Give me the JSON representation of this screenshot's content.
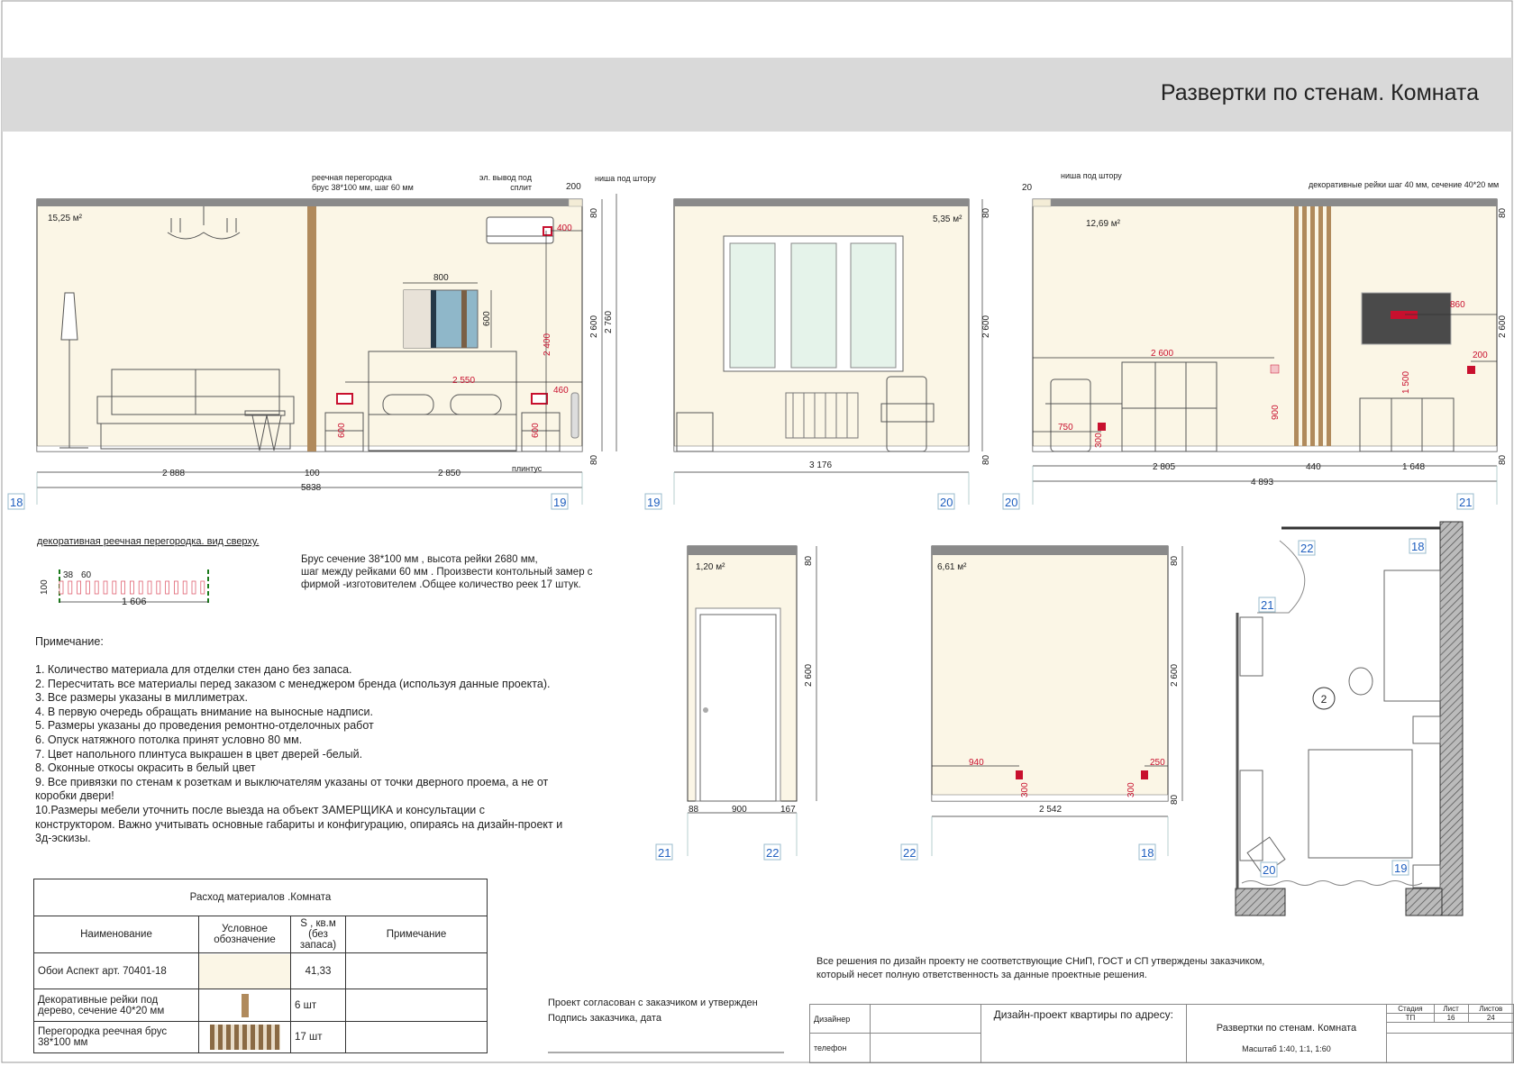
{
  "header": {
    "title": "Развертки по стенам. Комната"
  },
  "colors": {
    "wall": "#fbf6e6",
    "ceiling": "#8a8a8a",
    "header_band": "#d9d9d9",
    "accent_red": "#c8102e",
    "tag_blue": "#1f5fbf",
    "wood": "#b08a5c"
  },
  "elev1": {
    "area": "15,25 м²",
    "partition_note_1": "реечная перегородка",
    "partition_note_2": "брус 38*100 мм, шаг 60 мм",
    "outlet_note_1": "эл. вывод под",
    "outlet_note_2": "сплит",
    "niche_dim": "200",
    "niche_note": "ниша под штору",
    "d400": "400",
    "d800": "800",
    "d600": "600",
    "d2400": "2 400",
    "d2550": "2 550",
    "d460": "460",
    "d600a": "600",
    "d600b": "600",
    "d80top": "80",
    "d2600": "2 600",
    "d2760": "2 760",
    "d80bot": "80",
    "baseboard": "плинтус",
    "w1": "2 888",
    "w2": "100",
    "w3": "2 850",
    "total": "5838",
    "tag_left": "18",
    "tag_right": "19"
  },
  "elev2": {
    "area": "5,35 м²",
    "d80top": "80",
    "d2600": "2 600",
    "d80bot": "80",
    "width": "3 176",
    "tag_left": "19",
    "tag_right": "20"
  },
  "elev3": {
    "niche_dim": "20",
    "niche_note": "ниша под штору",
    "slats_note": "декоративные рейки шаг 40 мм, сечение 40*20 мм",
    "area": "12,69 м²",
    "d2600r": "2 600",
    "d750": "750",
    "d300": "300",
    "d900": "900",
    "d860": "860",
    "d200": "200",
    "d1500": "1 500",
    "d80top": "80",
    "d2600": "2 600",
    "d80bot": "80",
    "w1": "2 805",
    "w2": "440",
    "w3": "1 648",
    "total": "4 893",
    "tag_left": "20",
    "tag_right": "21"
  },
  "elev4": {
    "area": "1,20 м²",
    "d80": "80",
    "d2600": "2 600",
    "w1": "88",
    "w2": "900",
    "w3": "167",
    "tag_left": "21",
    "tag_right": "22"
  },
  "elev5": {
    "area": "6,61 м²",
    "d80top": "80",
    "d2600": "2 600",
    "d80bot": "80",
    "d940": "940",
    "d250": "250",
    "d300a": "300",
    "d300b": "300",
    "width": "2 542",
    "tag_left": "22",
    "tag_right": "18"
  },
  "plan": {
    "room_number": "2",
    "tags": [
      "22",
      "18",
      "21",
      "20",
      "19"
    ]
  },
  "partition_top": {
    "title": "декоративная реечная перегородка. вид сверху.",
    "d38": "38",
    "d60": "60",
    "d100": "100",
    "d1606": "1 606",
    "desc": [
      "Брус сечение 38*100 мм , высота рейки 2680 мм,",
      "шаг между рейками 60 мм . Произвести контольный замер с",
      "фирмой -изготовителем .Общее количество реек 17 штук."
    ]
  },
  "notes": {
    "title": "Примечание:",
    "items": [
      "1. Количество материала для отделки стен дано без запаса.",
      "2. Пересчитать все материалы перед заказом с менеджером бренда (используя данные проекта).",
      "3. Все размеры указаны в миллиметрах.",
      "4. В первую очередь обращать внимание на выносные надписи.",
      "5. Размеры указаны до проведения ремонтно-отделочных работ",
      "6. Опуск натяжного потолка принят условно 80 мм.",
      "7. Цвет напольного плинтуса выкрашен  в цвет дверей -белый.",
      "8. Оконные откосы окрасить в белый цвет",
      "9. Все привязки по стенам к розеткам и выключателям указаны от точки дверного проема, а не от",
      "коробки двери!",
      "10.Размеры мебели уточнить после выезда на объект ЗАМЕРЩИКА и консультации с",
      "конструктором. Важно учитывать основные габариты и конфигурацию, опираясь на дизайн-проект и",
      "3д-эскизы."
    ]
  },
  "materials": {
    "title": "Расход материалов .Комната",
    "headers": [
      "Наименование",
      "Условное обозначение",
      "S , кв.м (без запаса)",
      "Примечание"
    ],
    "rows": [
      {
        "name": "Обои Аспект арт. 70401-18",
        "qty": "41,33",
        "note": ""
      },
      {
        "name": "Декоративные рейки  под дерево, сечение 40*20 мм",
        "qty": "6 шт",
        "note": ""
      },
      {
        "name": "Перегородка реечная брус 38*100 мм",
        "qty": "17 шт",
        "note": ""
      }
    ]
  },
  "approval": {
    "line1": "Проект согласован с заказчиком и утвержден",
    "line2": "Подпись заказчика, дата"
  },
  "disclaimer": {
    "line1": "Все решения по дизайн проекту не соответствующие СНиП, ГОСТ и СП утверждены заказчиком,",
    "line2": "который несет полную ответственность за данные проектные решения."
  },
  "title_block": {
    "designer_label": "Дизайнер",
    "phone_label": "телефон",
    "project": "Дизайн-проект квартиры по адресу:",
    "sheet_title": "Развертки по стенам. Комната",
    "scale": "Масштаб 1:40, 1:1, 1:60",
    "stage_label": "Стадия",
    "sheet_label": "Лист",
    "sheets_label": "Листов",
    "stage": "ТП",
    "sheet": "16",
    "sheets": "24"
  }
}
